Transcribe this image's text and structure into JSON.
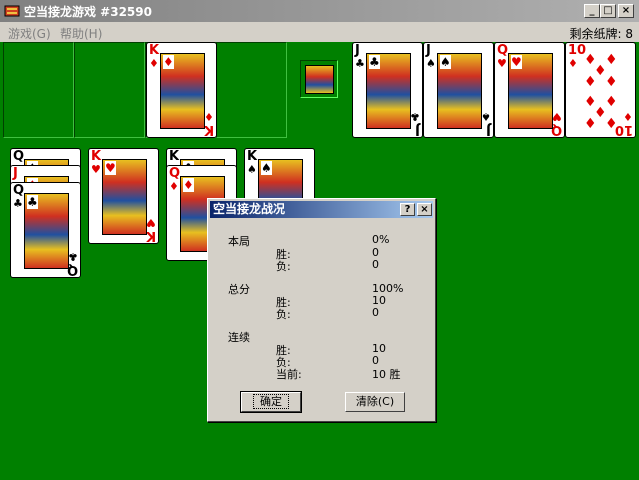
{
  "window": {
    "title": "空当接龙游戏 #32590",
    "minimize": "_",
    "maximize": "□",
    "close": "×"
  },
  "menu": {
    "game": "游戏(G)",
    "help": "帮助(H)",
    "cards_left_label": "剩余纸牌: 8"
  },
  "free_cells": [
    {
      "card": null
    },
    {
      "card": null
    },
    {
      "card": {
        "rank": "K",
        "suit": "♦",
        "color": "red"
      }
    },
    {
      "card": null
    }
  ],
  "foundations": [
    {
      "rank": "J",
      "suit": "♣",
      "color": "black"
    },
    {
      "rank": "J",
      "suit": "♠",
      "color": "black"
    },
    {
      "rank": "Q",
      "suit": "♥",
      "color": "red"
    },
    {
      "rank": "10",
      "suit": "♦",
      "color": "red"
    }
  ],
  "tableau": [
    [
      {
        "rank": "Q",
        "suit": "♠",
        "color": "black"
      },
      {
        "rank": "J",
        "suit": "♦",
        "color": "red"
      },
      {
        "rank": "Q",
        "suit": "♣",
        "color": "black"
      }
    ],
    [
      {
        "rank": "K",
        "suit": "♥",
        "color": "red"
      }
    ],
    [
      {
        "rank": "K",
        "suit": "♣",
        "color": "black"
      },
      {
        "rank": "Q",
        "suit": "♦",
        "color": "red"
      }
    ],
    [
      {
        "rank": "K",
        "suit": "♠",
        "color": "black"
      }
    ]
  ],
  "dialog": {
    "title": "空当接龙战况",
    "help_btn": "?",
    "close_btn": "×",
    "sections": {
      "current": {
        "label": "本局",
        "pct": "0%",
        "won_label": "胜:",
        "won": "0",
        "lost_label": "负:",
        "lost": "0"
      },
      "total": {
        "label": "总分",
        "pct": "100%",
        "won_label": "胜:",
        "won": "10",
        "lost_label": "负:",
        "lost": "0"
      },
      "streak": {
        "label": "连续",
        "won_label": "胜:",
        "won": "10",
        "lost_label": "负:",
        "lost": "0",
        "current_label": "当前:",
        "current": "10 胜"
      }
    },
    "ok_label": "确定",
    "clear_label": "清除(C)"
  }
}
